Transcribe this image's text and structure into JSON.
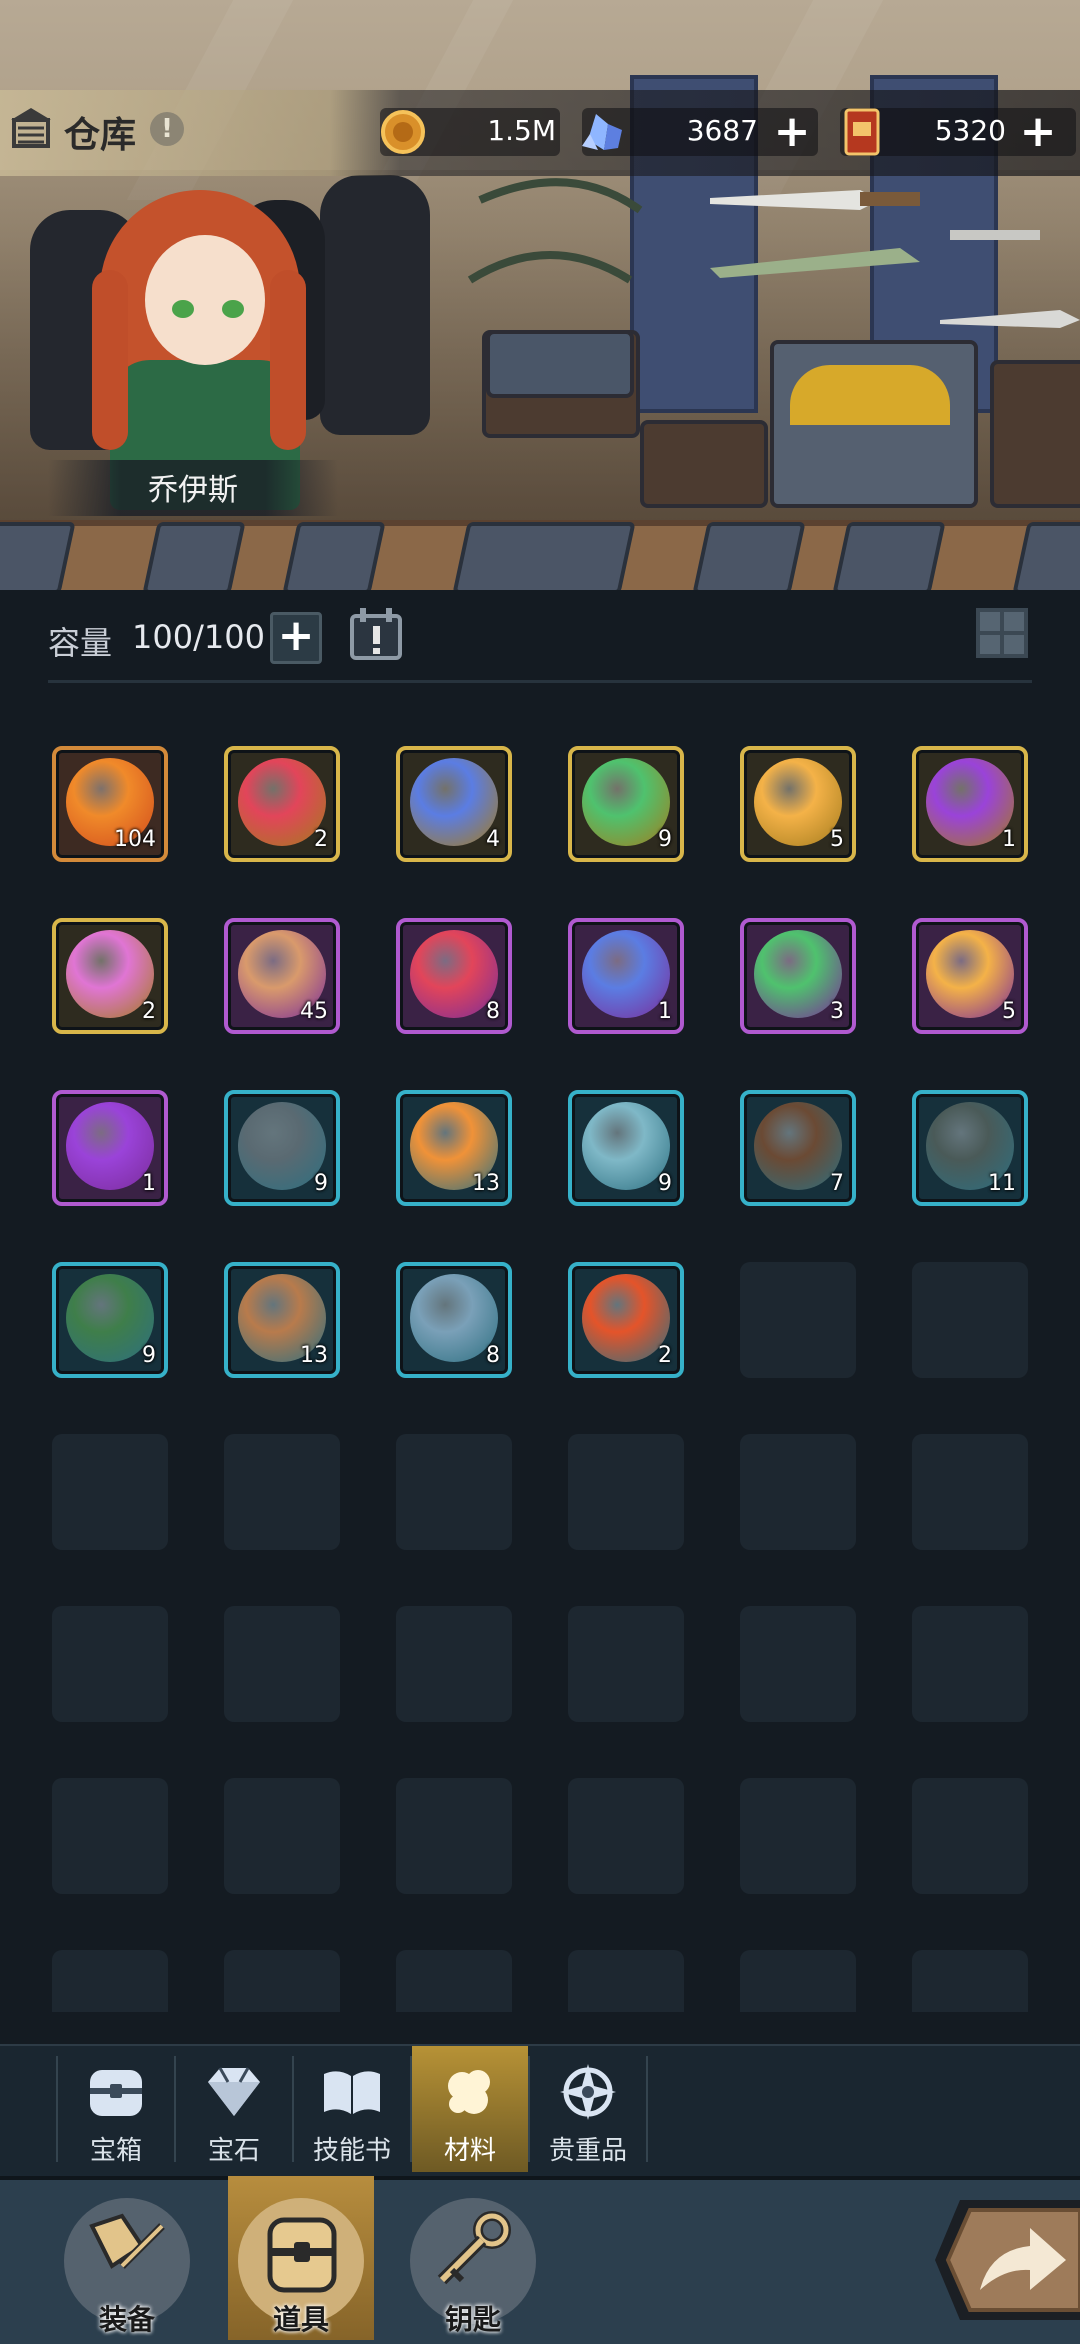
{
  "header": {
    "title": "仓库",
    "help_glyph": "!",
    "resources": [
      {
        "name": "gold-coin",
        "value": "1.5M",
        "icon": "coin-icon",
        "has_plus": false
      },
      {
        "name": "crystal",
        "value": "3687",
        "icon": "crystal-icon",
        "has_plus": true
      },
      {
        "name": "ticket-book",
        "value": "5320",
        "icon": "book-ticket-icon",
        "has_plus": true
      }
    ]
  },
  "hero": {
    "name": "乔伊斯"
  },
  "capacity": {
    "label": "容量",
    "value": "100/100"
  },
  "colors": {
    "orange": "#d38a3a",
    "gold": "#d8b64a",
    "purple": "#b05ad0",
    "teal": "#36b1c9",
    "background": "#141b22",
    "active_tab": "#b79236"
  },
  "items": [
    {
      "icon": "fire-essence-icon",
      "rarity": "orange",
      "qty": "104"
    },
    {
      "icon": "fist-essence-icon",
      "rarity": "gold",
      "qty": "2"
    },
    {
      "icon": "shield-essence-icon",
      "rarity": "gold",
      "qty": "4"
    },
    {
      "icon": "sprout-essence-icon",
      "rarity": "gold",
      "qty": "9"
    },
    {
      "icon": "star-compass-icon",
      "rarity": "gold",
      "qty": "5"
    },
    {
      "icon": "moon-orb-icon",
      "rarity": "gold",
      "qty": "1"
    },
    {
      "icon": "lotus-icon",
      "rarity": "gold",
      "qty": "2"
    },
    {
      "icon": "meat-leg-icon",
      "rarity": "purple",
      "qty": "45"
    },
    {
      "icon": "fist-essence-icon",
      "rarity": "purple",
      "qty": "8"
    },
    {
      "icon": "shield-essence-icon",
      "rarity": "purple",
      "qty": "1"
    },
    {
      "icon": "sprout-essence-icon",
      "rarity": "purple",
      "qty": "3"
    },
    {
      "icon": "star-compass-icon",
      "rarity": "purple",
      "qty": "5"
    },
    {
      "icon": "moon-orb-icon",
      "rarity": "purple",
      "qty": "1"
    },
    {
      "icon": "shadow-creature-icon",
      "rarity": "teal",
      "qty": "9"
    },
    {
      "icon": "fire-skull-icon",
      "rarity": "teal",
      "qty": "13"
    },
    {
      "icon": "ice-creature-icon",
      "rarity": "teal",
      "qty": "9"
    },
    {
      "icon": "tree-spirit-icon",
      "rarity": "teal",
      "qty": "7"
    },
    {
      "icon": "dark-cat-icon",
      "rarity": "teal",
      "qty": "11"
    },
    {
      "icon": "forest-dragon-icon",
      "rarity": "teal",
      "qty": "9"
    },
    {
      "icon": "deer-beast-icon",
      "rarity": "teal",
      "qty": "13"
    },
    {
      "icon": "frost-wolf-icon",
      "rarity": "teal",
      "qty": "8"
    },
    {
      "icon": "flame-spirit-icon",
      "rarity": "teal",
      "qty": "2"
    }
  ],
  "category_tabs": [
    {
      "label": "宝箱",
      "icon": "chest-icon",
      "active": false
    },
    {
      "label": "宝石",
      "icon": "gem-icon",
      "active": false
    },
    {
      "label": "技能书",
      "icon": "book-icon",
      "active": false
    },
    {
      "label": "材料",
      "icon": "material-icon",
      "active": true
    },
    {
      "label": "贵重品",
      "icon": "valuable-icon",
      "active": false
    }
  ],
  "bottom_nav": [
    {
      "label": "装备",
      "icon": "equipment-icon",
      "active": false
    },
    {
      "label": "道具",
      "icon": "item-bag-icon",
      "active": true
    },
    {
      "label": "钥匙",
      "icon": "key-icon",
      "active": false
    }
  ]
}
